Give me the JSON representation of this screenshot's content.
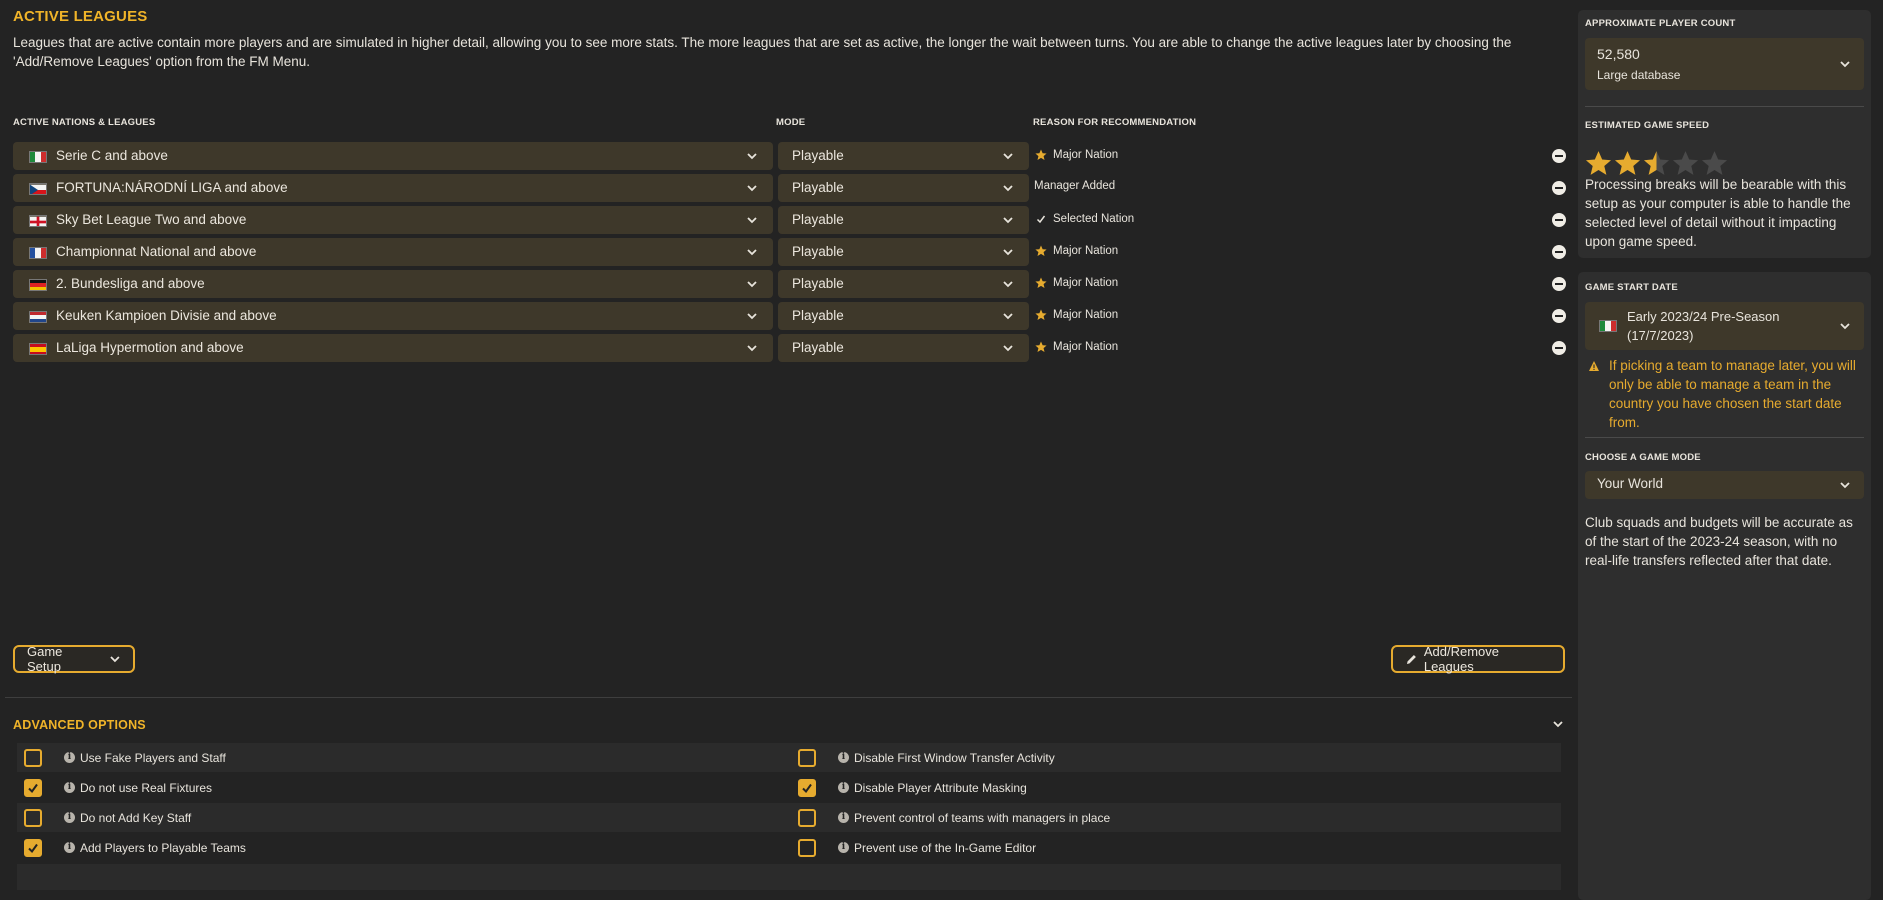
{
  "active_leagues": {
    "title": "ACTIVE LEAGUES",
    "description": "Leagues that are active contain more players and are simulated in higher detail, allowing you to see more stats. The more leagues that are set as active, the longer the wait between turns. You are able to change the active leagues later by choosing the 'Add/Remove Leagues' option from the FM Menu.",
    "columns": {
      "nations": "ACTIVE NATIONS & LEAGUES",
      "mode": "MODE",
      "reason": "REASON FOR RECOMMENDATION"
    },
    "rows": [
      {
        "league": "Serie C and above",
        "flag": "italy",
        "mode": "Playable",
        "reason": "Major Nation",
        "reason_icon": "star-icon"
      },
      {
        "league": "FORTUNA:NÁRODNÍ LIGA and above",
        "flag": "czech-republic",
        "mode": "Playable",
        "reason": "Manager Added",
        "reason_icon": ""
      },
      {
        "league": "Sky Bet League Two and above",
        "flag": "england",
        "mode": "Playable",
        "reason": "Selected Nation",
        "reason_icon": "check-icon"
      },
      {
        "league": "Championnat National and above",
        "flag": "france",
        "mode": "Playable",
        "reason": "Major Nation",
        "reason_icon": "star-icon"
      },
      {
        "league": "2. Bundesliga and above",
        "flag": "germany",
        "mode": "Playable",
        "reason": "Major Nation",
        "reason_icon": "star-icon"
      },
      {
        "league": "Keuken Kampioen Divisie and above",
        "flag": "netherlands",
        "mode": "Playable",
        "reason": "Major Nation",
        "reason_icon": "star-icon"
      },
      {
        "league": "LaLiga Hypermotion and above",
        "flag": "spain",
        "mode": "Playable",
        "reason": "Major Nation",
        "reason_icon": "star-icon"
      }
    ],
    "game_setup_label": "Game Setup",
    "add_remove_label": "Add/Remove Leagues"
  },
  "advanced_options": {
    "title": "ADVANCED OPTIONS",
    "rows": [
      [
        {
          "label": "Use Fake Players and Staff",
          "checked": false
        },
        {
          "label": "Disable First Window Transfer Activity",
          "checked": false
        }
      ],
      [
        {
          "label": "Do not use Real Fixtures",
          "checked": true
        },
        {
          "label": "Disable Player Attribute Masking",
          "checked": true
        }
      ],
      [
        {
          "label": "Do not Add Key Staff",
          "checked": false
        },
        {
          "label": "Prevent control of teams with managers in place",
          "checked": false
        }
      ],
      [
        {
          "label": "Add Players to Playable Teams",
          "checked": true
        },
        {
          "label": "Prevent use of the In-Game Editor",
          "checked": false
        }
      ]
    ]
  },
  "sidebar": {
    "player_count": {
      "heading": "APPROXIMATE PLAYER COUNT",
      "value": "52,580",
      "subtext": "Large database"
    },
    "game_speed": {
      "heading": "ESTIMATED GAME SPEED",
      "rating": 2.5,
      "max": 5,
      "description": "Processing breaks will be bearable with this setup as your computer is able to handle the selected level of detail without it impacting upon game speed."
    },
    "start_date": {
      "heading": "GAME START DATE",
      "value": "Early 2023/24 Pre-Season (17/7/2023)",
      "flag": "italy",
      "warning": "If picking a team to manage later, you will only be able to manage a team in the country you have chosen the start date from."
    },
    "game_mode": {
      "heading": "CHOOSE A GAME MODE",
      "value": "Your World",
      "description": "Club squads and budgets will be accurate as of the start of the 2023-24 season, with no real-life transfers reflected after that date."
    }
  },
  "colors": {
    "accent": "#f0b429",
    "dropdown_bg": "#3e382a",
    "background": "#232323",
    "panel_bg": "#2e2e2e"
  }
}
